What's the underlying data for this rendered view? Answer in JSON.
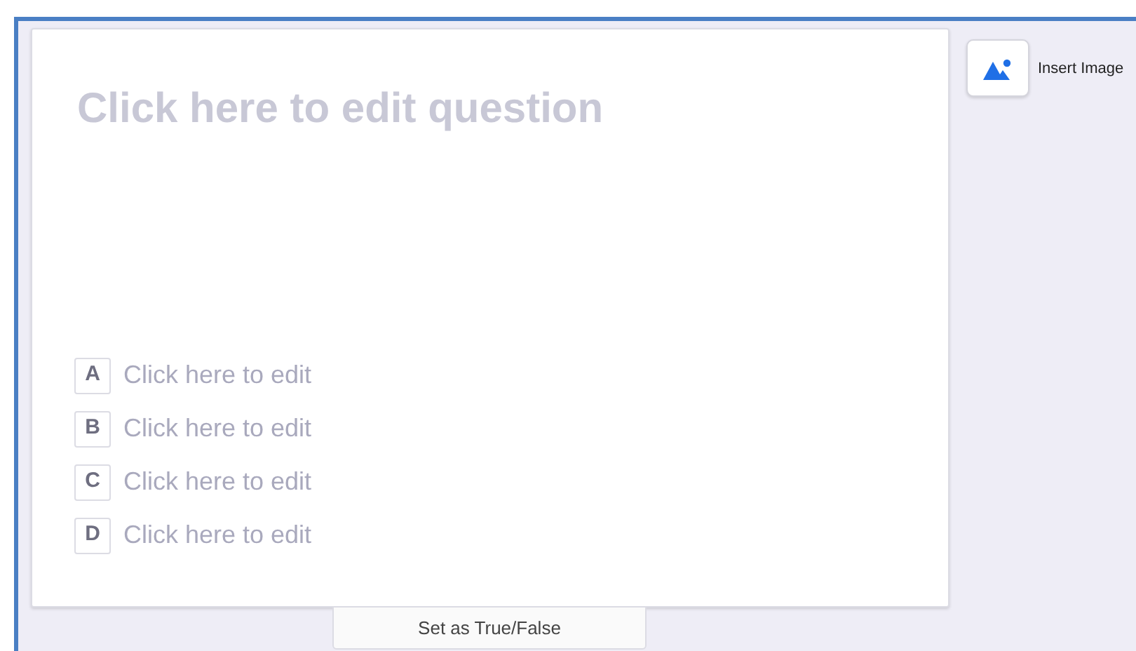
{
  "question": {
    "placeholder": "Click here to edit question"
  },
  "options": [
    {
      "letter": "A",
      "placeholder": "Click here to edit"
    },
    {
      "letter": "B",
      "placeholder": "Click here to edit"
    },
    {
      "letter": "C",
      "placeholder": "Click here to edit"
    },
    {
      "letter": "D",
      "placeholder": "Click here to edit"
    }
  ],
  "insert_image": {
    "label": "Insert Image"
  },
  "footer_button": {
    "label": "Set as True/False"
  }
}
